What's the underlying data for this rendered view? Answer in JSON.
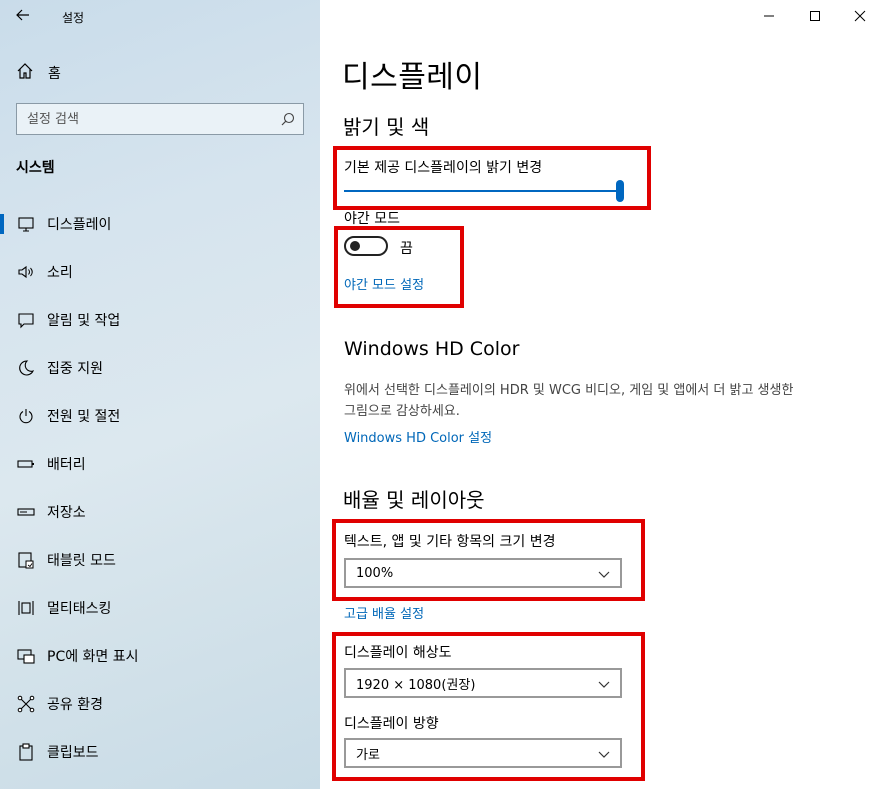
{
  "window": {
    "app_title": "설정",
    "minimize_glyph": "—",
    "maximize_glyph": "☐",
    "close_glyph": "✕"
  },
  "sidebar": {
    "home_label": "홈",
    "search": {
      "placeholder": "설정 검색"
    },
    "section_title": "시스템",
    "items": [
      {
        "label": "디스플레이",
        "icon": "monitor-icon",
        "active": true
      },
      {
        "label": "소리",
        "icon": "speaker-icon",
        "active": false
      },
      {
        "label": "알림 및 작업",
        "icon": "notification-icon",
        "active": false
      },
      {
        "label": "집중 지원",
        "icon": "moon-icon",
        "active": false
      },
      {
        "label": "전원 및 절전",
        "icon": "power-icon",
        "active": false
      },
      {
        "label": "배터리",
        "icon": "battery-icon",
        "active": false
      },
      {
        "label": "저장소",
        "icon": "storage-icon",
        "active": false
      },
      {
        "label": "태블릿 모드",
        "icon": "tablet-icon",
        "active": false
      },
      {
        "label": "멀티태스킹",
        "icon": "multitasking-icon",
        "active": false
      },
      {
        "label": "PC에 화면 표시",
        "icon": "project-icon",
        "active": false
      },
      {
        "label": "공유 환경",
        "icon": "share-icon",
        "active": false
      },
      {
        "label": "클립보드",
        "icon": "clipboard-icon",
        "active": false
      }
    ]
  },
  "main": {
    "page_title": "디스플레이",
    "brightness_section": {
      "heading": "밝기 및 색",
      "brightness_label": "기본 제공 디스플레이의 밝기 변경",
      "brightness_value": 100,
      "night_light_label": "야간 모드",
      "night_light_state": "끔",
      "night_light_on": false,
      "night_light_settings_link": "야간 모드 설정"
    },
    "hdr_section": {
      "heading": "Windows HD Color",
      "description": "위에서 선택한 디스플레이의 HDR 및 WCG 비디오, 게임 및 앱에서 더 밝고 생생한 그림으로 감상하세요.",
      "settings_link": "Windows HD Color 설정"
    },
    "scale_section": {
      "heading": "배율 및 레이아웃",
      "scale_label": "텍스트, 앱 및 기타 항목의 크기 변경",
      "scale_value": "100%",
      "advanced_scale_link": "고급 배율 설정",
      "resolution_label": "디스플레이 해상도",
      "resolution_value": "1920 × 1080(권장)",
      "orientation_label": "디스플레이 방향",
      "orientation_value": "가로"
    }
  },
  "colors": {
    "accent": "#0067c0",
    "link": "#0067b8",
    "highlight_border": "#e00000"
  }
}
